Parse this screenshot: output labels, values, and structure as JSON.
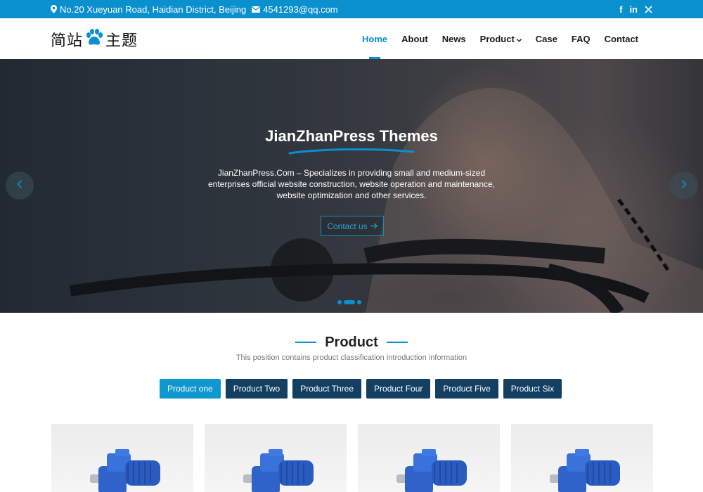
{
  "topbar": {
    "address": "No.20 Xueyuan Road, Haidian District, Beijing",
    "email": "4541293@qq.com",
    "social": [
      "facebook-icon",
      "linkedin-icon",
      "x-icon"
    ],
    "facebook": "f",
    "linkedin": "in"
  },
  "header": {
    "logo_text_1": "简站",
    "logo_text_2": "主题",
    "nav": [
      "Home",
      "About",
      "News",
      "Product",
      "Case",
      "FAQ",
      "Contact"
    ],
    "active_nav": "Home"
  },
  "hero": {
    "title": "JianZhanPress Themes",
    "description": "JianZhanPress.Com – Specializes in providing small and medium-sized enterprises official website construction, website operation and maintenance, website optimization and other services.",
    "button": "Contact us",
    "slide_count": 3,
    "active_slide": 2
  },
  "product": {
    "title": "Product",
    "subtitle": "This position contains product classification introduction information",
    "tabs": [
      "Product one",
      "Product Two",
      "Product Three",
      "Product Four",
      "Product Five",
      "Product Six"
    ],
    "active_tab": "Product one"
  },
  "colors": {
    "accent": "#0a8fcf",
    "tab_dark": "#123f62"
  }
}
